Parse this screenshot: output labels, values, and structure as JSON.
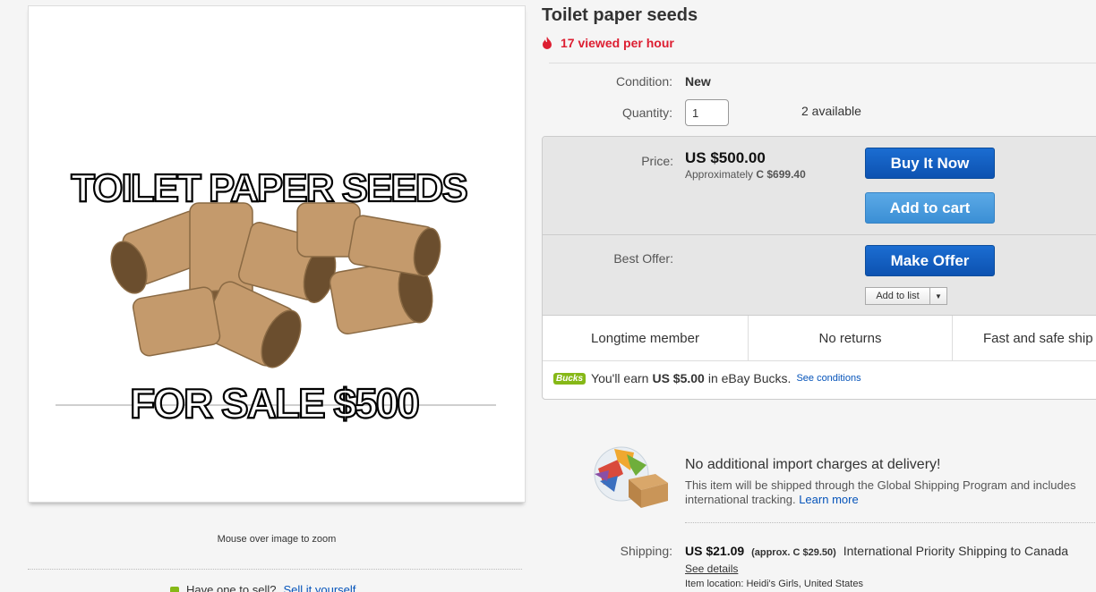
{
  "image": {
    "headline": "TOILET PAPER SEEDS",
    "footer": "FOR SALE $500",
    "zoom_hint": "Mouse over image to zoom"
  },
  "listing": {
    "title": "Toilet paper seeds",
    "viewed": "17 viewed per hour",
    "condition_label": "Condition:",
    "condition_value": "New",
    "quantity_label": "Quantity:",
    "quantity_value": "1",
    "available": "2 available"
  },
  "buybox": {
    "price_label": "Price:",
    "price": "US $500.00",
    "approx_prefix": "Approximately",
    "approx_value": "C $699.40",
    "buy_now": "Buy It Now",
    "add_to_cart": "Add to cart",
    "best_offer_label": "Best Offer:",
    "make_offer": "Make Offer",
    "add_to_list": "Add to list"
  },
  "features": [
    "Longtime member",
    "No returns",
    "Fast and safe ship"
  ],
  "bucks": {
    "badge": "Bucks",
    "text_before": "You'll earn",
    "amount": "US $5.00",
    "text_after": "in eBay Bucks.",
    "link": "See conditions"
  },
  "shipping": {
    "gsp_title": "No additional import charges at delivery!",
    "gsp_desc": "This item will be shipped through the Global Shipping Program and includes international tracking.",
    "learn_more": "Learn more",
    "label": "Shipping:",
    "cost": "US $21.09",
    "approx": "(approx. C $29.50)",
    "service": "International Priority Shipping to Canada",
    "see_details": "See details",
    "location": "Item location:  Heidi's Girls, United States"
  },
  "left_teaser": {
    "text": "Have one to sell?",
    "link": "Sell it yourself"
  },
  "colors": {
    "accent_blue": "#0654ba",
    "viewed_red": "#dd1e31",
    "bucks_green": "#86b817"
  }
}
